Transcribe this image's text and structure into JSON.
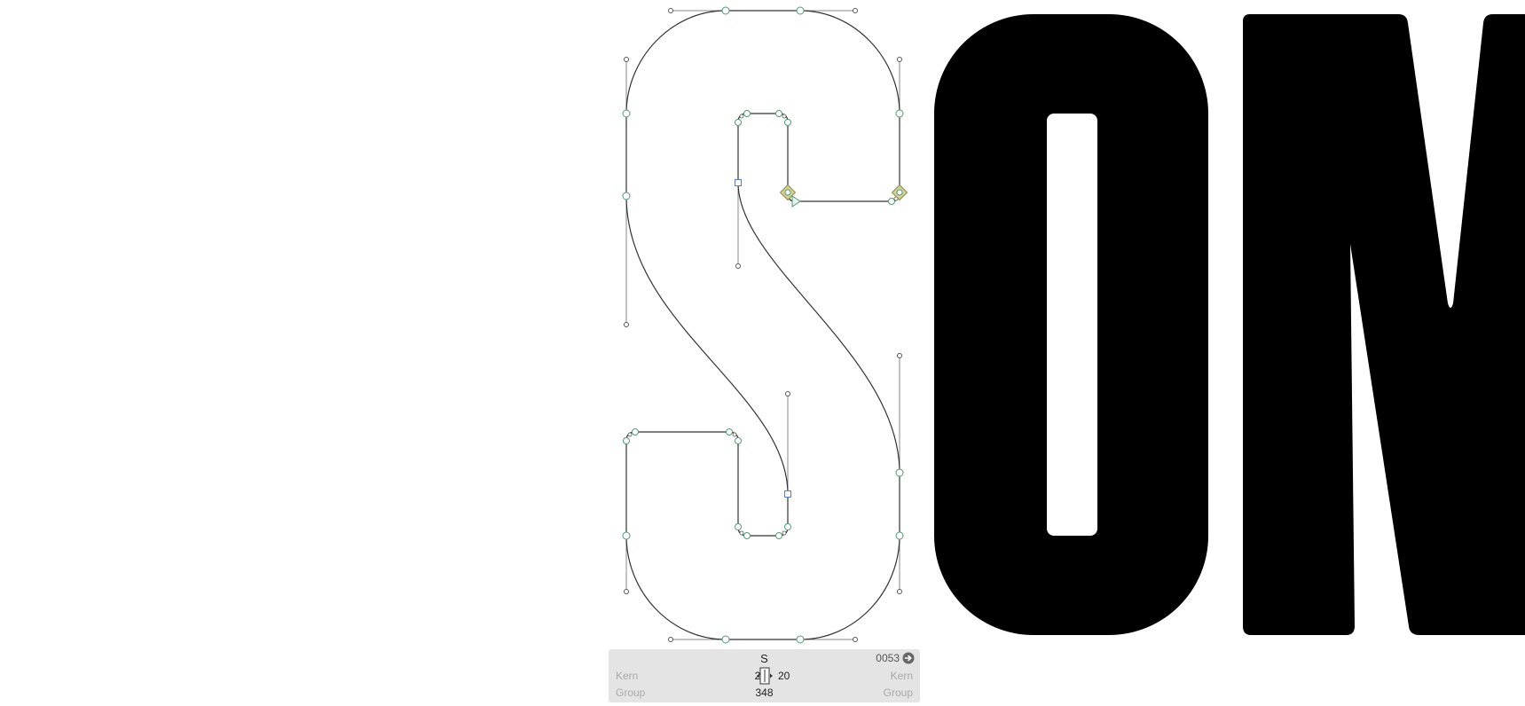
{
  "editor": {
    "background": "#ffffff",
    "preview_letters": [
      "O",
      "M"
    ],
    "edit_glyph": "S",
    "outline_color": "#333333",
    "node_color": "#4f9c74",
    "selection_color": "#b7b06a",
    "handle_color": "#8a8a8a",
    "square_node_color": "#5b7fc0",
    "fill_color": "#000000"
  },
  "glyph_panel": {
    "glyph_name": "S",
    "unicode": "0053",
    "unicode_icon": "arrow-right-circle-icon",
    "left_kern_label": "Kern",
    "right_kern_label": "Kern",
    "left_group_label": "Group",
    "right_group_label": "Group",
    "lsb": "20",
    "rsb": "20",
    "width": "348",
    "metrics_icon": "sidebearings-icon",
    "background": "#e4e4e4"
  }
}
